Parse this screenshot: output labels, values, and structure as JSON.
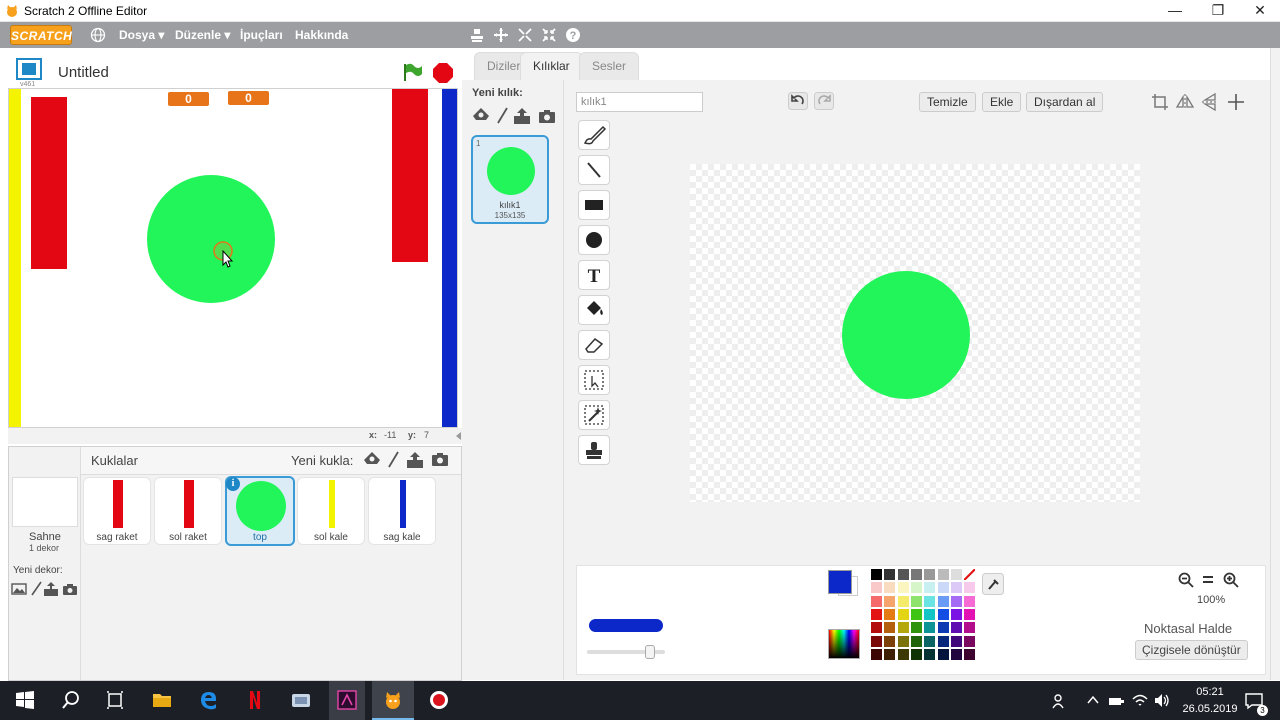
{
  "window": {
    "title": "Scratch 2 Offline Editor",
    "minimize": "—",
    "maximize": "❐",
    "close": "✕"
  },
  "menu": {
    "logo": "SCRATCH",
    "items": [
      "Dosya ▾",
      "Düzenle ▾",
      "İpuçları",
      "Hakkında"
    ]
  },
  "stage": {
    "project_title": "Untitled",
    "version": "v461",
    "score_left": "0",
    "score_right": "0",
    "coords": {
      "x_label": "x:",
      "x": "-11",
      "y_label": "y:",
      "y": "7"
    }
  },
  "sprites": {
    "header": "Kuklalar",
    "new_sprite_label": "Yeni kukla:",
    "stage_name": "Sahne",
    "stage_sub": "1 dekor",
    "new_backdrop_label": "Yeni dekor:",
    "items": [
      {
        "name": "sag raket",
        "color": "#e30613"
      },
      {
        "name": "sol raket",
        "color": "#e30613"
      },
      {
        "name": "top",
        "color": "#22f55a"
      },
      {
        "name": "sol kale",
        "color": "#f4f400"
      },
      {
        "name": "sag kale",
        "color": "#0d28c9"
      }
    ]
  },
  "tabs": [
    "Diziler",
    "Kılıklar",
    "Sesler"
  ],
  "costumes": {
    "new_label": "Yeni kılık:",
    "items": [
      {
        "index": "1",
        "name": "kılık1",
        "size": "135x135"
      }
    ]
  },
  "editor": {
    "costume_name_value": "kılık1",
    "btn_clear": "Temizle",
    "btn_add": "Ekle",
    "btn_import": "Dışardan al",
    "zoom": "100%",
    "mode_label": "Noktasal Halde",
    "convert_btn": "Çizgisele dönüştür",
    "fill_color": "#22f55a",
    "selected_color": "#0d28c9"
  },
  "taskbar": {
    "time": "05:21",
    "date": "26.05.2019",
    "notif_count": "3"
  }
}
